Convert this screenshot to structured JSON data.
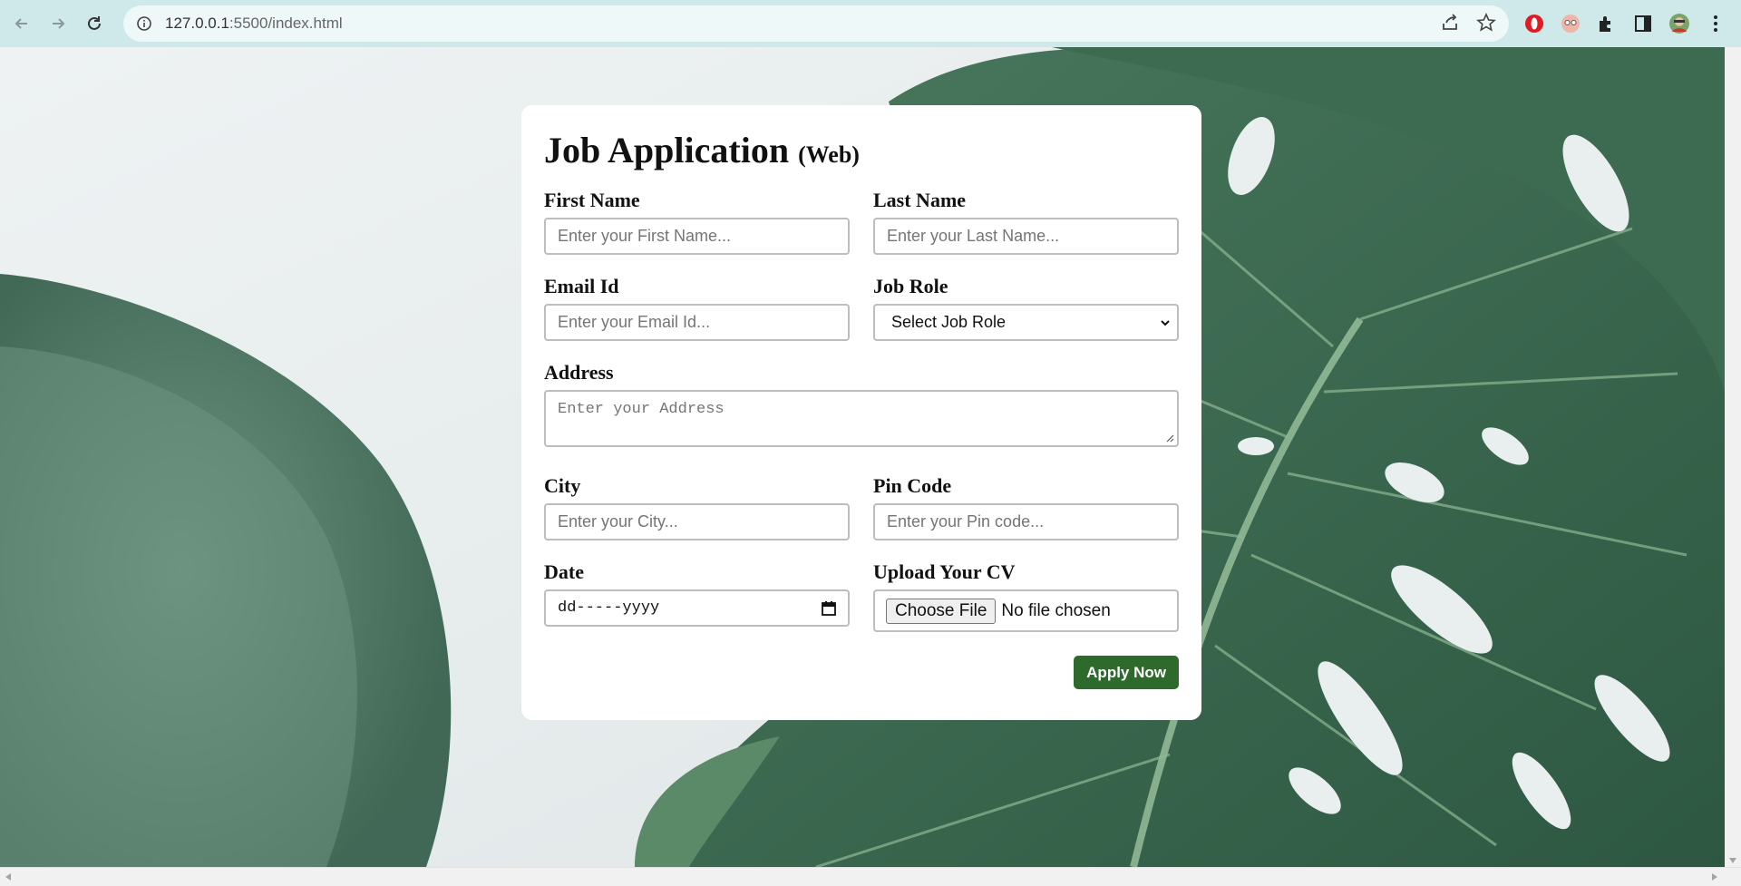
{
  "browser": {
    "url_host": "127.0.0.1",
    "url_rest": ":5500/index.html"
  },
  "form": {
    "title": "Job Application",
    "subtitle": "(Web)",
    "first_name": {
      "label": "First Name",
      "placeholder": "Enter your First Name..."
    },
    "last_name": {
      "label": "Last Name",
      "placeholder": "Enter your Last Name..."
    },
    "email": {
      "label": "Email Id",
      "placeholder": "Enter your Email Id..."
    },
    "job_role": {
      "label": "Job Role",
      "selected": "Select Job Role"
    },
    "address": {
      "label": "Address",
      "placeholder": "Enter your Address"
    },
    "city": {
      "label": "City",
      "placeholder": "Enter your City..."
    },
    "pin_code": {
      "label": "Pin Code",
      "placeholder": "Enter your Pin code..."
    },
    "date": {
      "label": "Date",
      "value": "dd-----yyyy"
    },
    "cv": {
      "label": "Upload Your CV",
      "button": "Choose File",
      "status": "No file chosen"
    },
    "submit_label": "Apply Now"
  },
  "colors": {
    "chrome_bg": "#cfe8ea",
    "accent_button": "#2d6a2b"
  }
}
